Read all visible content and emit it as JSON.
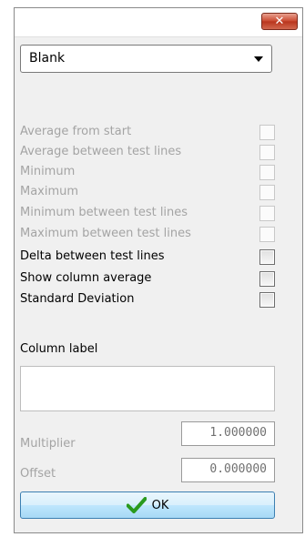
{
  "window": {
    "close_glyph": "✕"
  },
  "mode_select": {
    "value": "Blank"
  },
  "options": [
    {
      "label": "Average from start",
      "enabled": false,
      "checked": false
    },
    {
      "label": "Average between test lines",
      "enabled": false,
      "checked": false
    },
    {
      "label": "Minimum",
      "enabled": false,
      "checked": false
    },
    {
      "label": "Maximum",
      "enabled": false,
      "checked": false
    },
    {
      "label": "Minimum between test lines",
      "enabled": false,
      "checked": false
    },
    {
      "label": "Maximum between test lines",
      "enabled": false,
      "checked": false
    },
    {
      "label": "Delta between test lines",
      "enabled": true,
      "checked": false
    },
    {
      "label": "Show column average",
      "enabled": true,
      "checked": false
    },
    {
      "label": "Standard Deviation",
      "enabled": true,
      "checked": false
    }
  ],
  "column_label": {
    "label": "Column label",
    "value": ""
  },
  "multiplier": {
    "label": "Multiplier",
    "value": "1.000000"
  },
  "offset": {
    "label": "Offset",
    "value": "0.000000"
  },
  "ok_button": {
    "label": "OK",
    "icon": "checkmark-icon",
    "icon_color": "#2a9a1e"
  },
  "colors": {
    "enabled_text": "#000000",
    "disabled_text": "#a4a4a4",
    "close_button": "#c9462c",
    "ok_button_border": "#3c7fb1"
  }
}
